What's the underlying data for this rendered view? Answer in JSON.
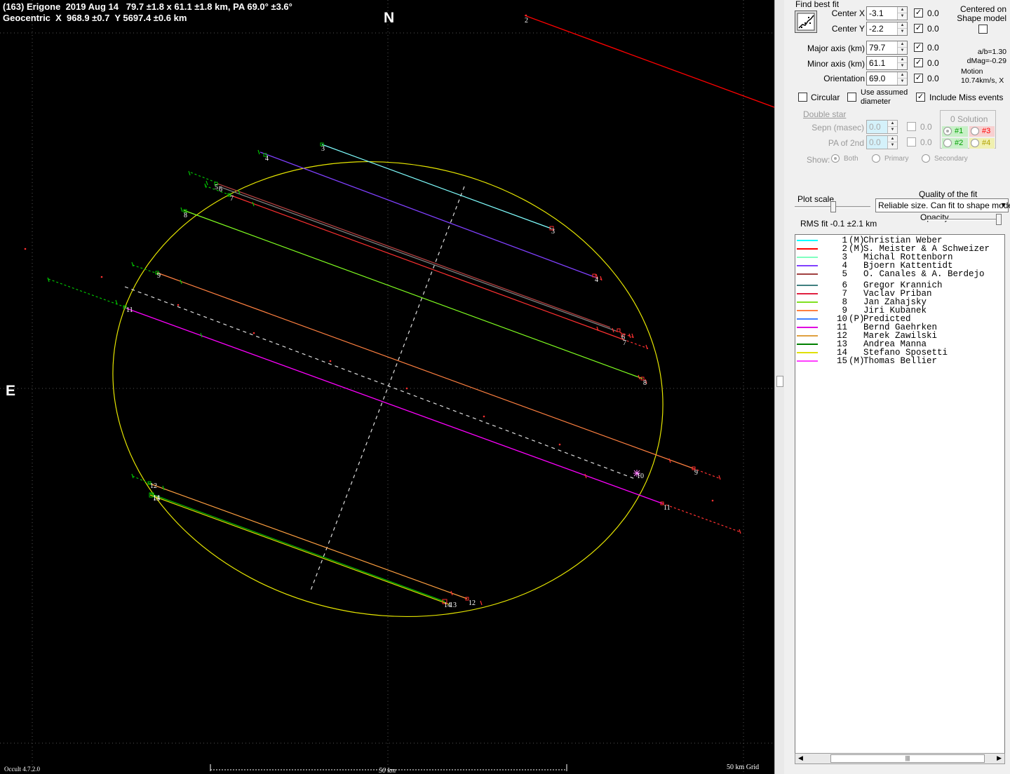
{
  "header": {
    "line1": "(163) Erigone  2019 Aug 14   79.7 ±1.8 x 61.1 ±1.8 km, PA 69.0° ±3.6°",
    "line2": "Geocentric  X  968.9 ±0.7  Y 5697.4 ±0.6 km"
  },
  "compass": {
    "north": "N",
    "east": "E"
  },
  "footer": {
    "version": "Occult 4.7.2.0",
    "scale_label": "50 km",
    "grid_label": "50 km Grid"
  },
  "chords": [
    {
      "label": "2",
      "color": "#ff0000"
    },
    {
      "label": "3",
      "color": "#80ffff"
    },
    {
      "label": "4",
      "color": "#8040ff"
    },
    {
      "label": "5",
      "color": "#b04040"
    },
    {
      "label": "6",
      "color": "#808080"
    },
    {
      "label": "7",
      "color": "#ff3030"
    },
    {
      "label": "8",
      "color": "#80ff20"
    },
    {
      "label": "9",
      "color": "#ff8040"
    },
    {
      "label": "10",
      "color": "#ffffff"
    },
    {
      "label": "11",
      "color": "#ff00ff"
    },
    {
      "label": "12",
      "color": "#ffa040"
    },
    {
      "label": "13",
      "color": "#00c000"
    },
    {
      "label": "14",
      "color": "#e0e000"
    }
  ],
  "panel": {
    "find_best_fit": "Find best fit",
    "fit_icon": "scatter-fit-icon",
    "center_x": {
      "label": "Center X",
      "value": "-3.1",
      "checked": true,
      "uncert": "0.0"
    },
    "center_y": {
      "label": "Center Y",
      "value": "-2.2",
      "checked": true,
      "uncert": "0.0"
    },
    "major": {
      "label": "Major axis (km)",
      "value": "79.7",
      "checked": true,
      "uncert": "0.0"
    },
    "minor": {
      "label": "Minor axis (km)",
      "value": "61.1",
      "checked": true,
      "uncert": "0.0"
    },
    "orient": {
      "label": "Orientation",
      "value": "69.0",
      "checked": true,
      "uncert": "0.0"
    },
    "centered_on": "Centered on",
    "shape_model": "Shape model",
    "ab_ratio": "a/b=1.30",
    "dmag": "dMag=-0.29",
    "motion": "Motion",
    "motion_val": "10.74km/s, X",
    "circular": "Circular",
    "use_assumed_1": "Use assumed",
    "use_assumed_2": "diameter",
    "include_miss": "Include Miss events",
    "double_star": "Double star",
    "sepn": {
      "label": "Sepn (masec)",
      "value": "0.0",
      "uncert": "0.0"
    },
    "pa2": {
      "label": "PA of 2nd",
      "value": "0.0",
      "uncert": "0.0"
    },
    "show_label": "Show:",
    "show_opts": [
      "Both",
      "Primary",
      "Secondary"
    ],
    "solution_title": "0 Solution",
    "solutions": [
      {
        "label": "#1",
        "color": "#00a000"
      },
      {
        "label": "#3",
        "color": "#ff0000"
      },
      {
        "label": "#2",
        "color": "#00a000"
      },
      {
        "label": "#4",
        "color": "#b0a000"
      }
    ],
    "plot_scale": "Plot scale",
    "quality_label": "Quality of the fit",
    "quality_value": "Reliable size. Can fit to shape mode",
    "opacity": "Opacity",
    "rms": "RMS fit -0.1 ±2.1 km"
  },
  "legend": [
    {
      "num": "1",
      "tag": "(M)",
      "name": "Christian Weber",
      "color": "#00ffff"
    },
    {
      "num": "2",
      "tag": "(M)",
      "name": "S. Meister & A Schweizer",
      "color": "#ff0000"
    },
    {
      "num": "3",
      "tag": "",
      "name": "Michal Rottenborn",
      "color": "#80ffc0"
    },
    {
      "num": "4",
      "tag": "",
      "name": "Bjoern Kattentidt",
      "color": "#8040ff"
    },
    {
      "num": "5",
      "tag": "",
      "name": "O. Canales & A. Berdejo",
      "color": "#a04040"
    },
    {
      "num": "6",
      "tag": "",
      "name": "Gregor Krannich",
      "color": "#408080"
    },
    {
      "num": "7",
      "tag": "",
      "name": "Vaclav Priban",
      "color": "#e02040"
    },
    {
      "num": "8",
      "tag": "",
      "name": "Jan Zahajsky",
      "color": "#80e020"
    },
    {
      "num": "9",
      "tag": "",
      "name": "Jiri Kubanek",
      "color": "#ff8040"
    },
    {
      "num": "10",
      "tag": "(P)",
      "name": "Predicted",
      "color": "#4080ff"
    },
    {
      "num": "11",
      "tag": "",
      "name": "Bernd Gaehrken",
      "color": "#e000e0"
    },
    {
      "num": "12",
      "tag": "",
      "name": "Marek Zawilski",
      "color": "#e0a040"
    },
    {
      "num": "13",
      "tag": "",
      "name": "Andrea Manna",
      "color": "#008000"
    },
    {
      "num": "14",
      "tag": "",
      "name": "Stefano Sposetti",
      "color": "#e0e000"
    },
    {
      "num": "15",
      "tag": "(M)",
      "name": "Thomas Bellier",
      "color": "#ff40ff"
    }
  ],
  "hscroll_thumb": "|||"
}
